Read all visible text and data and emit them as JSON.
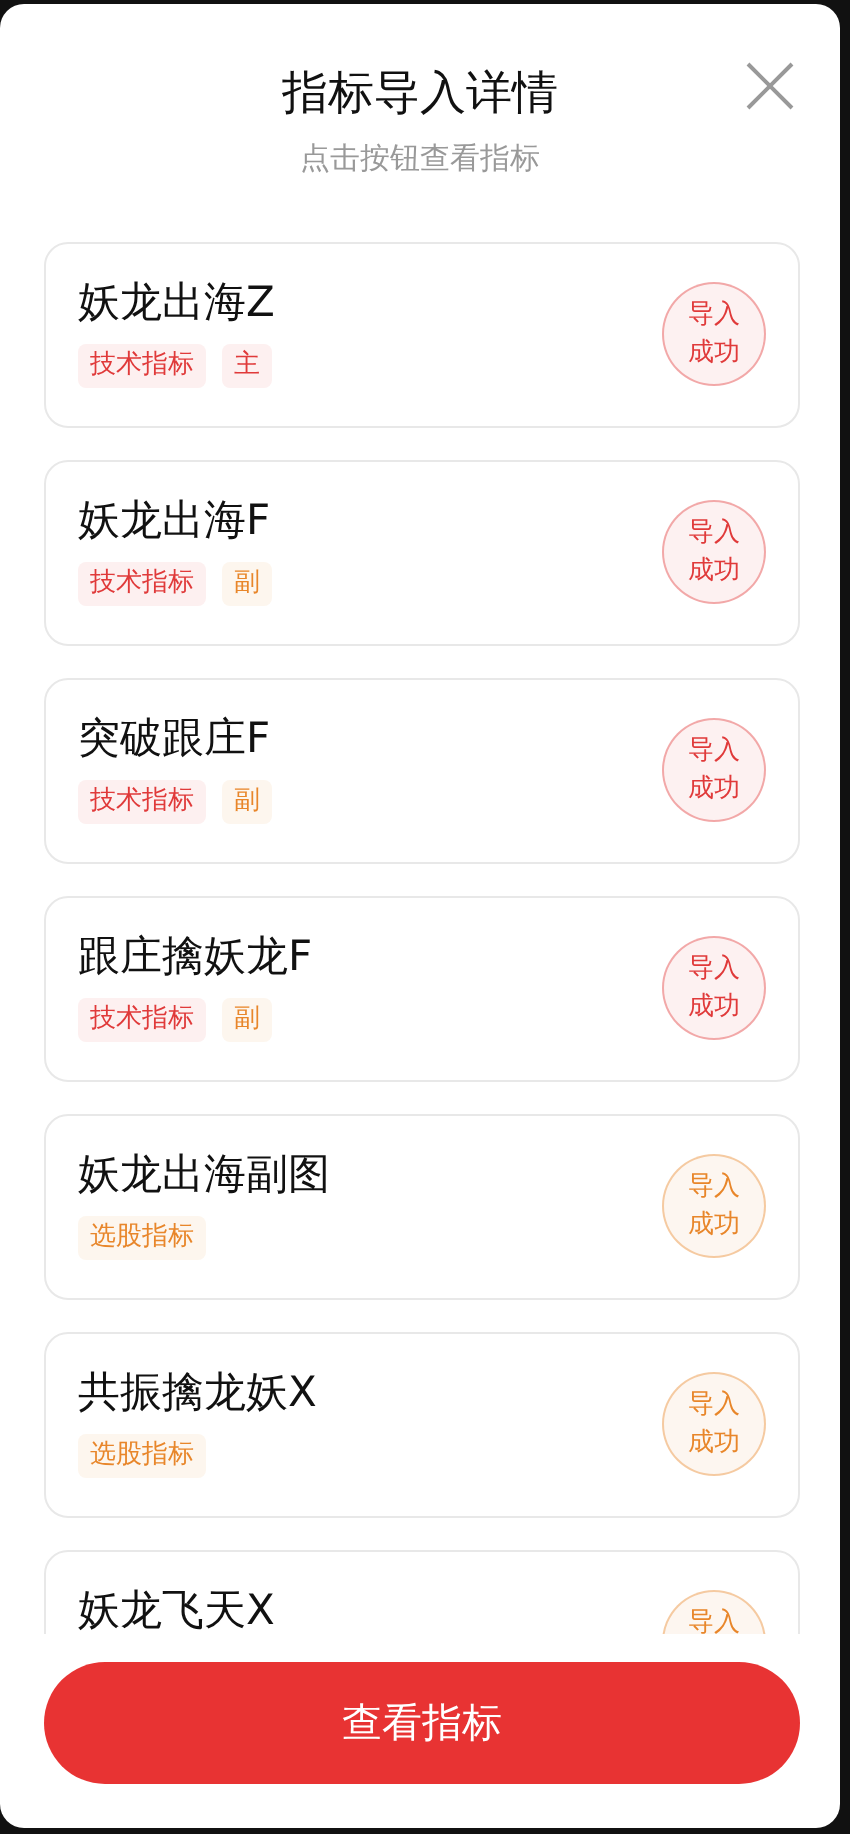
{
  "dialog": {
    "title": "指标导入详情",
    "subtitle": "点击按钮查看指标"
  },
  "items": [
    {
      "name": "妖龙出海Z",
      "tags": [
        {
          "text": "技术指标",
          "color": "#e03a3a"
        },
        {
          "text": "主",
          "color": "#e03a3a"
        }
      ],
      "status": {
        "lines": [
          "导入",
          "成功"
        ],
        "color": "#e03a3a"
      }
    },
    {
      "name": "妖龙出海F",
      "tags": [
        {
          "text": "技术指标",
          "color": "#e03a3a"
        },
        {
          "text": "副",
          "color": "#e8862a"
        }
      ],
      "status": {
        "lines": [
          "导入",
          "成功"
        ],
        "color": "#e03a3a"
      }
    },
    {
      "name": "突破跟庄F",
      "tags": [
        {
          "text": "技术指标",
          "color": "#e03a3a"
        },
        {
          "text": "副",
          "color": "#e8862a"
        }
      ],
      "status": {
        "lines": [
          "导入",
          "成功"
        ],
        "color": "#e03a3a"
      }
    },
    {
      "name": "跟庄擒妖龙F",
      "tags": [
        {
          "text": "技术指标",
          "color": "#e03a3a"
        },
        {
          "text": "副",
          "color": "#e8862a"
        }
      ],
      "status": {
        "lines": [
          "导入",
          "成功"
        ],
        "color": "#e03a3a"
      }
    },
    {
      "name": "妖龙出海副图",
      "tags": [
        {
          "text": "选股指标",
          "color": "#e8862a"
        }
      ],
      "status": {
        "lines": [
          "导入",
          "成功"
        ],
        "color": "#e8862a"
      }
    },
    {
      "name": "共振擒龙妖X",
      "tags": [
        {
          "text": "选股指标",
          "color": "#e8862a"
        }
      ],
      "status": {
        "lines": [
          "导入",
          "成功"
        ],
        "color": "#e8862a"
      }
    },
    {
      "name": "妖龙飞天X",
      "status": {
        "lines": [
          "导入"
        ],
        "color": "#e8862a"
      }
    }
  ],
  "button": "查看指标"
}
